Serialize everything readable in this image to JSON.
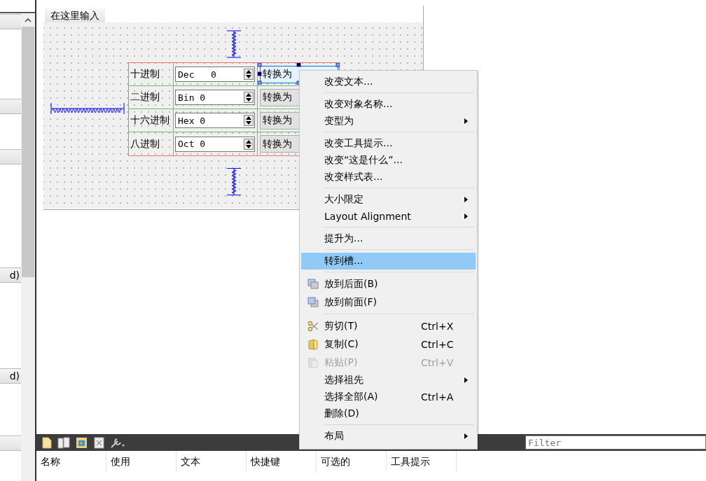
{
  "sidebar": {
    "headers": [
      {
        "label": "d)"
      },
      {
        "label": "d)"
      }
    ]
  },
  "form": {
    "tab": "在这里输入",
    "rows": [
      {
        "label": "十进制",
        "spin_value": "Dec   0",
        "button": "转换为",
        "selected": true
      },
      {
        "label": "二进制",
        "spin_value": "Bin 0",
        "button": "转换为",
        "selected": false
      },
      {
        "label": "十六进制",
        "spin_value": "Hex 0",
        "button": "转换为",
        "selected": false
      },
      {
        "label": "八进制",
        "spin_value": "Oct 0",
        "button": "转换为",
        "selected": false
      }
    ]
  },
  "context_menu": [
    {
      "kind": "item",
      "label": "改变文本...",
      "submenu": false,
      "disabled": false,
      "selected": false
    },
    {
      "kind": "separator"
    },
    {
      "kind": "item",
      "label": "改变对象名称...",
      "submenu": false,
      "disabled": false,
      "selected": false
    },
    {
      "kind": "item",
      "label": "变型为",
      "submenu": true,
      "disabled": false,
      "selected": false
    },
    {
      "kind": "separator"
    },
    {
      "kind": "item",
      "label": "改变工具提示...",
      "submenu": false,
      "disabled": false,
      "selected": false
    },
    {
      "kind": "item",
      "label": "改变“这是什么”...",
      "submenu": false,
      "disabled": false,
      "selected": false
    },
    {
      "kind": "item",
      "label": "改变样式表...",
      "submenu": false,
      "disabled": false,
      "selected": false
    },
    {
      "kind": "separator"
    },
    {
      "kind": "item",
      "label": "大小限定",
      "submenu": true,
      "disabled": false,
      "selected": false
    },
    {
      "kind": "item",
      "label": "Layout Alignment",
      "submenu": true,
      "disabled": false,
      "selected": false
    },
    {
      "kind": "separator"
    },
    {
      "kind": "item",
      "label": "提升为...",
      "submenu": false,
      "disabled": false,
      "selected": false
    },
    {
      "kind": "separator"
    },
    {
      "kind": "item",
      "label": "转到槽...",
      "submenu": false,
      "disabled": false,
      "selected": true
    },
    {
      "kind": "separator"
    },
    {
      "kind": "icon_item",
      "label": "放到后面(B)",
      "submenu": false,
      "disabled": false,
      "selected": false
    },
    {
      "kind": "icon_item",
      "label": "放到前面(F)",
      "submenu": false,
      "disabled": false,
      "selected": false
    },
    {
      "kind": "separator"
    },
    {
      "kind": "icon_item",
      "label": "剪切(T)",
      "shortcut": "Ctrl+X",
      "submenu": false,
      "disabled": false,
      "selected": false
    },
    {
      "kind": "icon_item",
      "label": "复制(C)",
      "shortcut": "Ctrl+C",
      "submenu": false,
      "disabled": false,
      "selected": false
    },
    {
      "kind": "icon_item",
      "label": "粘贴(P)",
      "shortcut": "Ctrl+V",
      "submenu": false,
      "disabled": true,
      "selected": false
    },
    {
      "kind": "item",
      "label": "选择祖先",
      "submenu": true,
      "disabled": false,
      "selected": false
    },
    {
      "kind": "item",
      "label": "选择全部(A)",
      "shortcut": "Ctrl+A",
      "submenu": false,
      "disabled": false,
      "selected": false
    },
    {
      "kind": "item",
      "label": "删除(D)",
      "submenu": false,
      "disabled": false,
      "selected": false
    },
    {
      "kind": "separator"
    },
    {
      "kind": "item",
      "label": "布局",
      "submenu": true,
      "disabled": false,
      "selected": false
    }
  ],
  "action_editor": {
    "filter": {
      "placeholder": "Filter"
    },
    "columns": [
      "名称",
      "使用",
      "文本",
      "快捷键",
      "可选的",
      "工具提示"
    ]
  }
}
